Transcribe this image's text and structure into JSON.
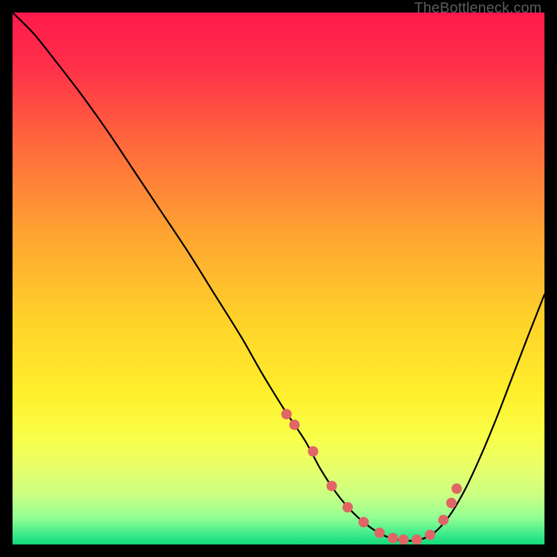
{
  "watermark": "TheBottleneck.com",
  "chart_data": {
    "type": "line",
    "title": "",
    "xlabel": "",
    "ylabel": "",
    "xlim": [
      0,
      100
    ],
    "ylim": [
      0,
      100
    ],
    "grid": false,
    "gradient_stops": [
      {
        "offset": 0.0,
        "color": "#ff1a4b"
      },
      {
        "offset": 0.1,
        "color": "#ff2f4a"
      },
      {
        "offset": 0.25,
        "color": "#ff6a3c"
      },
      {
        "offset": 0.42,
        "color": "#ffa531"
      },
      {
        "offset": 0.58,
        "color": "#ffd22a"
      },
      {
        "offset": 0.72,
        "color": "#fff02c"
      },
      {
        "offset": 0.8,
        "color": "#f9ff4a"
      },
      {
        "offset": 0.86,
        "color": "#e6ff6c"
      },
      {
        "offset": 0.91,
        "color": "#c8ff84"
      },
      {
        "offset": 0.95,
        "color": "#93ff93"
      },
      {
        "offset": 0.985,
        "color": "#32e88a"
      },
      {
        "offset": 1.0,
        "color": "#15d977"
      }
    ],
    "series": [
      {
        "name": "bottleneck-curve",
        "x": [
          0,
          4,
          8,
          13,
          18,
          23,
          28,
          33,
          38,
          43,
          47,
          51,
          55,
          58,
          61,
          64,
          67,
          70,
          73,
          76,
          79,
          82,
          85,
          88,
          91,
          94,
          97,
          100
        ],
        "y": [
          100,
          96,
          91,
          84.5,
          77.5,
          70,
          62.5,
          55,
          47,
          39,
          32,
          25.5,
          19.5,
          14,
          9.5,
          6,
          3.4,
          1.6,
          0.8,
          0.8,
          2.0,
          5.2,
          10.2,
          16.6,
          23.8,
          31.6,
          39.4,
          47.0
        ]
      }
    ],
    "markers": {
      "name": "highlight-dots",
      "color": "#e06666",
      "radius": 7.5,
      "x": [
        51.5,
        53.0,
        56.5,
        60.0,
        63.0,
        66.0,
        69.0,
        71.5,
        73.5,
        76.0,
        78.5,
        81.0,
        82.5,
        83.5
      ],
      "y": [
        24.5,
        22.5,
        17.5,
        11.0,
        7.0,
        4.2,
        2.2,
        1.2,
        0.9,
        0.9,
        1.8,
        4.6,
        7.8,
        10.5
      ]
    }
  }
}
